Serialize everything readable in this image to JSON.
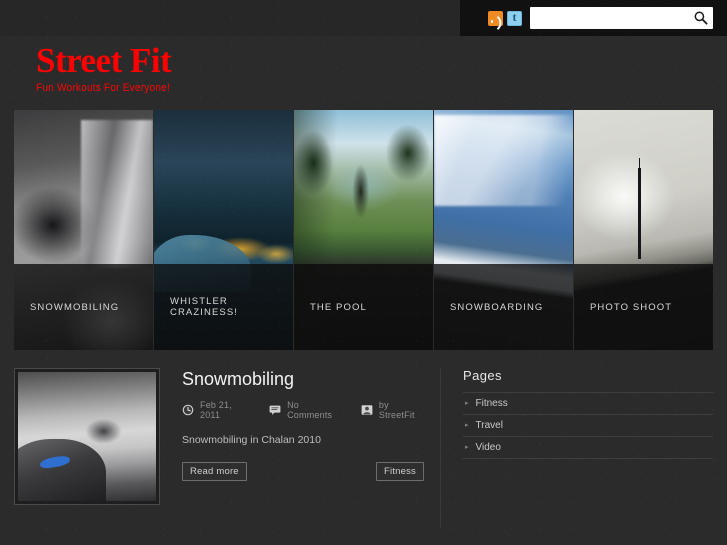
{
  "topbar": {
    "rss_icon": "rss-icon",
    "twitter_icon": "twitter-icon",
    "search_placeholder": "",
    "search_value": "",
    "search_icon": "search-icon"
  },
  "header": {
    "title": "Street Fit",
    "tagline": "Fun Workouts For Everyone!",
    "title_color": "#ff0000"
  },
  "featured": [
    {
      "caption": "SNOWMOBILING",
      "art": "ph-snowmobile"
    },
    {
      "caption": "WHISTLER CRAZINESS!",
      "art": "ph-whistler"
    },
    {
      "caption": "THE POOL",
      "art": "ph-pool"
    },
    {
      "caption": "SNOWBOARDING",
      "art": "ph-snowboard"
    },
    {
      "caption": "PHOTO SHOOT",
      "art": "ph-photoshoot"
    }
  ],
  "post": {
    "title": "Snowmobiling",
    "thumbnail_alt": "snowmobiling-photo",
    "meta": {
      "date_icon": "clock-icon",
      "date": "Feb 21, 2011",
      "comments_icon": "comment-icon",
      "comments": "No Comments",
      "author_icon": "user-icon",
      "author": "by StreetFit"
    },
    "excerpt": "Snowmobiling in Chalan 2010",
    "read_more_label": "Read more",
    "category_label": "Fitness"
  },
  "sidebar": {
    "widget_title": "Pages",
    "items": [
      {
        "label": "Fitness"
      },
      {
        "label": "Travel"
      },
      {
        "label": "Video"
      }
    ]
  }
}
